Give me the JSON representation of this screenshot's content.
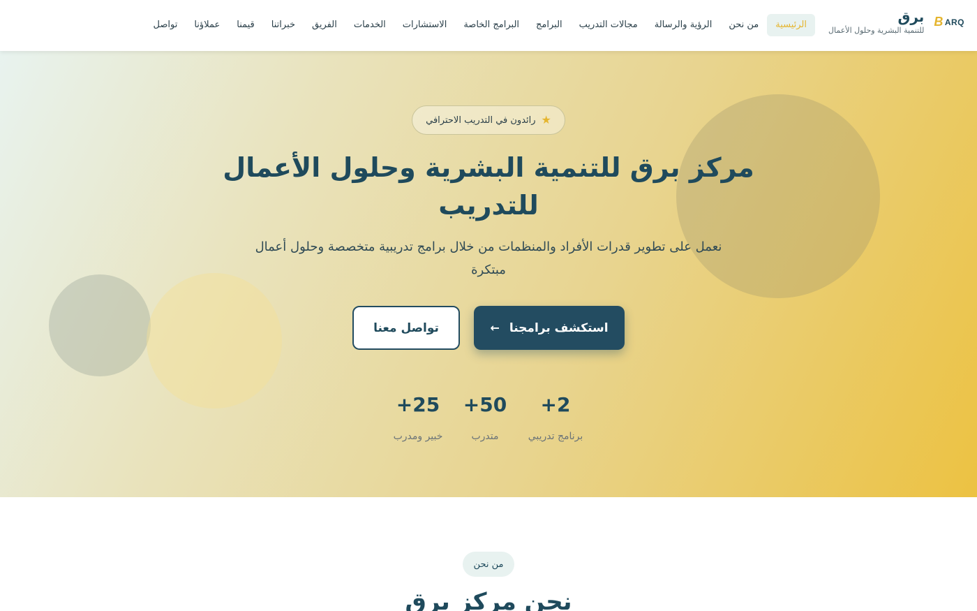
{
  "header": {
    "logo_mark": "ARQ",
    "logo_glyph": "B",
    "logo_title": "برق",
    "logo_subtitle": "للتنمية البشرية وحلول الأعمال",
    "nav": [
      {
        "label": "الرئيسية",
        "active": true
      },
      {
        "label": "من نحن"
      },
      {
        "label": "الرؤية والرسالة"
      },
      {
        "label": "مجالات التدريب"
      },
      {
        "label": "البرامج"
      },
      {
        "label": "البرامج الخاصة"
      },
      {
        "label": "الاستشارات"
      },
      {
        "label": "الخدمات"
      },
      {
        "label": "الفريق"
      },
      {
        "label": "خبراتنا"
      },
      {
        "label": "قيمنا"
      },
      {
        "label": "عملاؤنا"
      },
      {
        "label": "تواصل"
      }
    ]
  },
  "hero": {
    "badge": "رائدون في التدريب الاحترافي",
    "badge_icon": "star-icon",
    "title": "مركز برق للتنمية البشرية وحلول الأعمال للتدريب",
    "description": "نعمل على تطوير قدرات الأفراد والمنظمات من خلال برامج تدريبية متخصصة وحلول أعمال مبتكرة",
    "primary_button": "استكشف برامجنا",
    "primary_button_icon": "arrow-left-icon",
    "secondary_button": "تواصل معنا",
    "stats": [
      {
        "value": "+2",
        "label": "برنامج تدريبي"
      },
      {
        "value": "+50",
        "label": "متدرب"
      },
      {
        "value": "+25",
        "label": "خبير ومدرب"
      }
    ]
  },
  "about": {
    "pill": "من نحن",
    "title": "نحن مركز برق"
  },
  "colors": {
    "primary": "#234c61",
    "accent": "#e5b52f",
    "text": "#1f4a5c"
  }
}
